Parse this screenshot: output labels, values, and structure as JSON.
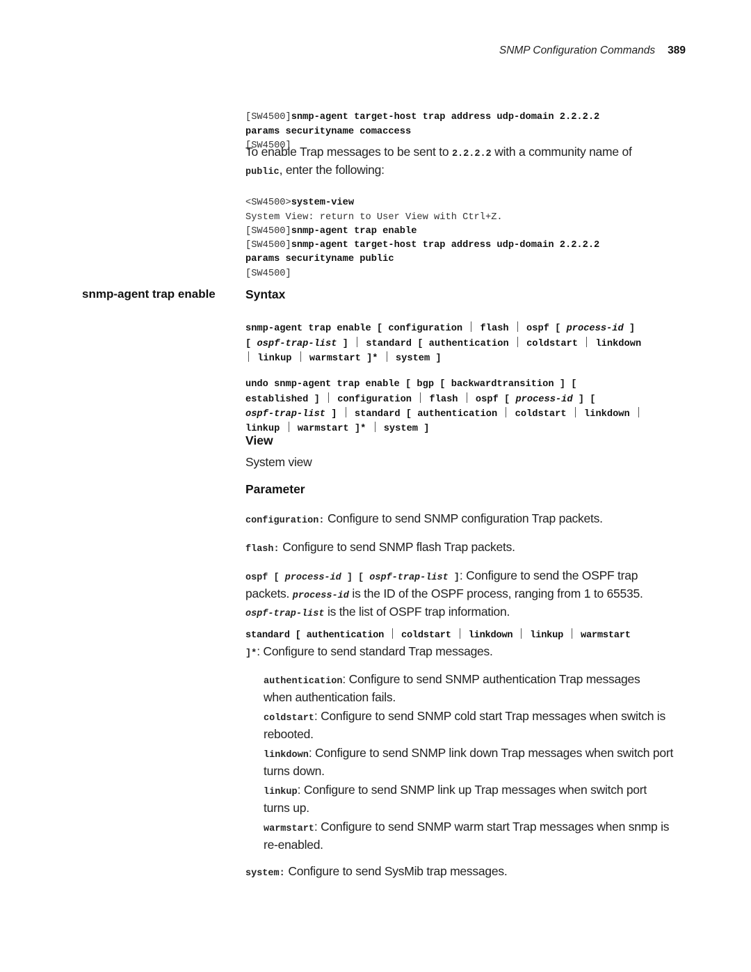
{
  "header": {
    "running_title": "SNMP Configuration Commands",
    "page_number": "389"
  },
  "example1": {
    "line1_prompt": "[SW4500]",
    "line1_cmd": "snmp-agent target-host trap address udp-domain 2.2.2.2",
    "line2_cmd": "params securityname comaccess",
    "line3_prompt": "[SW4500]"
  },
  "intro": {
    "text_a": "To enable Trap messages to be sent to ",
    "code_a": "2.2.2.2",
    "text_b": " with a community name of",
    "code_b": "public",
    "text_c": ", enter the following:"
  },
  "example2": {
    "line1_prompt": "<SW4500>",
    "line1_cmd": "system-view",
    "line2_output": "System View: return to User View with Ctrl+Z.",
    "line3_prompt": "[SW4500]",
    "line3_cmd": "snmp-agent trap enable",
    "line4_prompt": "[SW4500]",
    "line4_cmd": "snmp-agent target-host trap address udp-domain 2.2.2.2",
    "line5_cmd": "params securityname public",
    "line6_prompt": "[SW4500]"
  },
  "command": {
    "name": "snmp-agent trap enable"
  },
  "syntax": {
    "heading": "Syntax",
    "enable": {
      "l1_a": "snmp-agent trap enable [ configuration ",
      "l1_b": " flash ",
      "l1_c": " ospf [ ",
      "l1_d": "process-id",
      "l1_e": " ]",
      "l2_a": "[ ",
      "l2_b": "ospf-trap-list",
      "l2_c": " ] ",
      "l2_d": " standard [ authentication ",
      "l2_e": " coldstart ",
      "l2_f": " linkdown",
      "l3_a": " linkup ",
      "l3_b": " warmstart ]* ",
      "l3_c": " system ]"
    },
    "undo": {
      "l1": "undo snmp-agent trap enable [ bgp [ backwardtransition ] [",
      "l2_a": "established ] ",
      "l2_b": " configuration ",
      "l2_c": " flash ",
      "l2_d": " ospf [ ",
      "l2_e": "process-id",
      "l2_f": " ] [",
      "l3_a": "ospf-trap-list",
      "l3_b": " ] ",
      "l3_c": " standard [ authentication ",
      "l3_d": " coldstart ",
      "l3_e": " linkdown ",
      "l4_a": "linkup ",
      "l4_b": " warmstart ]* ",
      "l4_c": " system ]"
    }
  },
  "view": {
    "heading": "View",
    "text": "System view"
  },
  "parameter": {
    "heading": "Parameter",
    "configuration": {
      "key": "configuration:",
      "desc": " Configure to send SNMP configuration Trap packets."
    },
    "flash": {
      "key": "flash:",
      "desc": " Configure to send SNMP flash Trap packets."
    },
    "ospf": {
      "key_a": "ospf [ ",
      "key_b": "process-id",
      "key_c": " ] [ ",
      "key_d": "ospf-trap-list",
      "key_e": " ]",
      "desc_a": ": Configure to send the OSPF trap",
      "desc_b": "packets. ",
      "code_pid": "process-id",
      "desc_c": " is the ID of the OSPF process, ranging from 1 to 65535.",
      "code_list": "ospf-trap-list",
      "desc_d": " is the list of OSPF trap information."
    },
    "standard": {
      "key_a": "standard [ authentication ",
      "key_b": " coldstart ",
      "key_c": " linkdown ",
      "key_d": " linkup ",
      "key_e": " warmstart",
      "key_f": "]*",
      "desc": ": Configure to send standard Trap messages."
    },
    "sub_items": [
      {
        "key": "authentication",
        "desc_1": ": Configure to send SNMP authentication Trap messages",
        "desc_2": "when authentication fails."
      },
      {
        "key": "coldstart",
        "desc_1": ": Configure to send SNMP cold start Trap messages when switch is",
        "desc_2": "rebooted."
      },
      {
        "key": "linkdown",
        "desc_1": ": Configure to send SNMP link down Trap messages when switch port",
        "desc_2": "turns down."
      },
      {
        "key": "linkup",
        "desc_1": ": Configure to send SNMP link up Trap messages when switch port",
        "desc_2": "turns up."
      },
      {
        "key": "warmstart",
        "desc_1": ": Configure to send SNMP warm start Trap messages when snmp is",
        "desc_2": "re-enabled."
      }
    ],
    "system": {
      "key": "system:",
      "desc": " Configure to send SysMib trap messages."
    }
  }
}
